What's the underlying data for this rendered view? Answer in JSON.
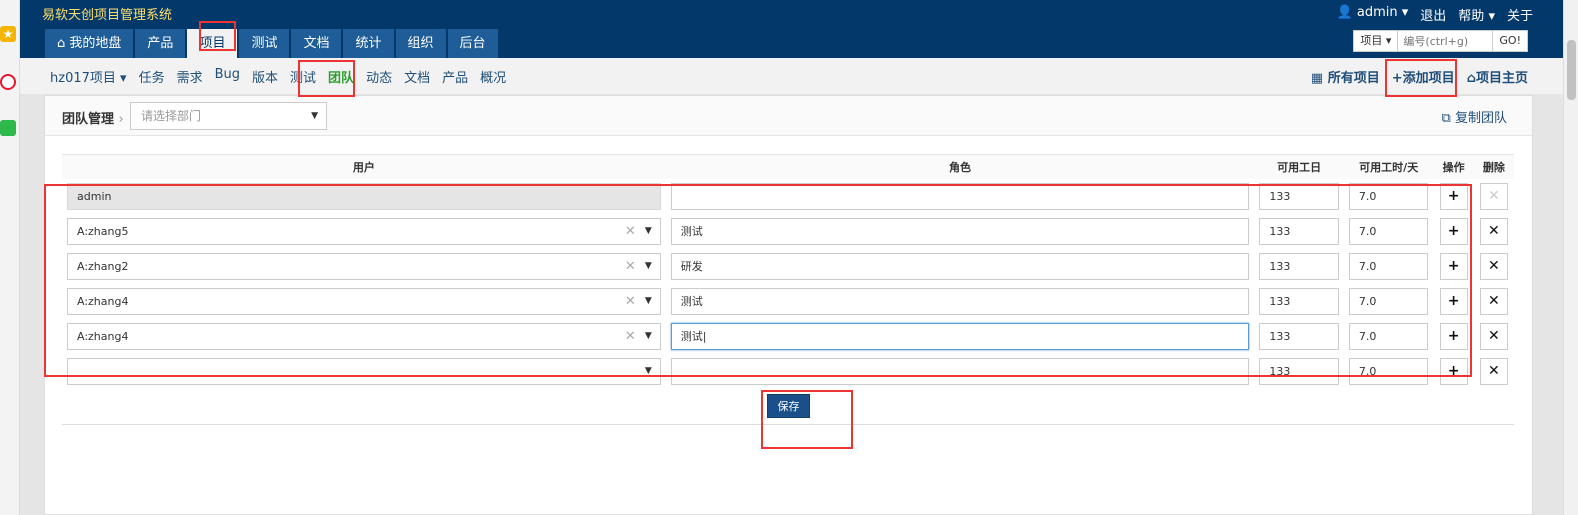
{
  "app": {
    "title": "易软天创项目管理系统",
    "user": "admin",
    "logout": "退出",
    "help": "帮助",
    "about": "关于"
  },
  "main_nav": [
    {
      "label": "我的地盘",
      "icon": "home-icon"
    },
    {
      "label": "产品"
    },
    {
      "label": "项目",
      "active": true
    },
    {
      "label": "测试"
    },
    {
      "label": "文档"
    },
    {
      "label": "统计"
    },
    {
      "label": "组织"
    },
    {
      "label": "后台"
    }
  ],
  "search": {
    "type": "项目",
    "placeholder": "编号(ctrl+g)",
    "go": "GO!"
  },
  "sub_nav": {
    "project": "hz017项目",
    "items": [
      "任务",
      "需求",
      "Bug",
      "版本",
      "测试",
      "团队",
      "动态",
      "文档",
      "产品",
      "概况"
    ],
    "active": "团队",
    "right": {
      "all": "所有项目",
      "add": "添加项目",
      "home": "项目主页"
    }
  },
  "team": {
    "breadcrumb": "团队管理",
    "dept_placeholder": "请选择部门",
    "copy": "复制团队",
    "headers": [
      "用户",
      "角色",
      "可用工日",
      "可用工时/天",
      "操作",
      "删除"
    ],
    "rows": [
      {
        "user": "admin",
        "role": "",
        "days": "133",
        "hours": "7.0",
        "readonly": true
      },
      {
        "user": "A:zhang5",
        "role": "测试",
        "days": "133",
        "hours": "7.0"
      },
      {
        "user": "A:zhang2",
        "role": "研发",
        "days": "133",
        "hours": "7.0"
      },
      {
        "user": "A:zhang4",
        "role": "测试",
        "days": "133",
        "hours": "7.0"
      },
      {
        "user": "A:zhang4",
        "role": "测试",
        "days": "133",
        "hours": "7.0",
        "focus": true
      },
      {
        "user": "",
        "role": "",
        "days": "133",
        "hours": "7.0"
      }
    ],
    "save": "保存"
  },
  "colors": {
    "header": "#03386b",
    "tab": "#1f5d98",
    "annotation": "#ee3333",
    "save": "#1a4f8a"
  }
}
